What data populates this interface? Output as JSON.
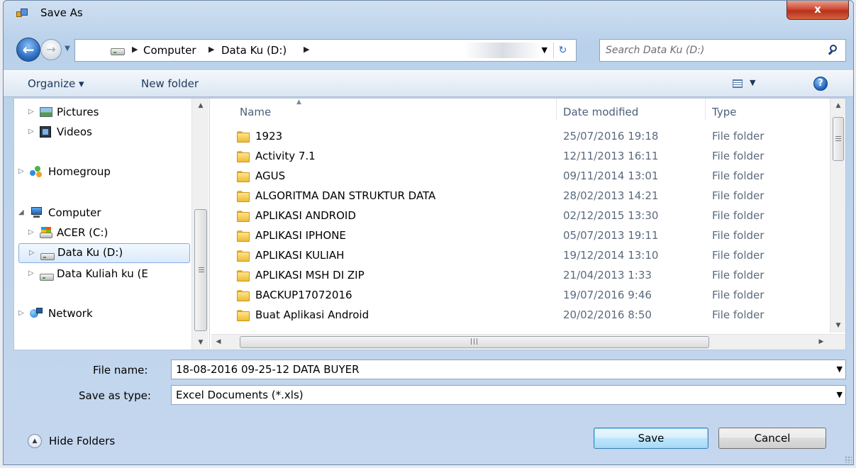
{
  "window": {
    "title": "Save As",
    "close_label": "x"
  },
  "nav": {
    "breadcrumbs": [
      "Computer",
      "Data Ku (D:)"
    ],
    "search_placeholder": "Search Data Ku (D:)"
  },
  "toolbar": {
    "organize": "Organize ▾",
    "new_folder": "New folder"
  },
  "tree": [
    {
      "label": "Pictures",
      "icon": "pictures-icon"
    },
    {
      "label": "Videos",
      "icon": "videos-icon"
    },
    {
      "label": "Homegroup",
      "icon": "homegroup-icon"
    },
    {
      "label": "Computer",
      "icon": "computer-icon"
    },
    {
      "label": "ACER (C:)",
      "icon": "drive-c-icon"
    },
    {
      "label": "Data Ku (D:)",
      "icon": "drive-icon",
      "selected": true
    },
    {
      "label": "Data Kuliah ku (E",
      "icon": "drive-icon"
    },
    {
      "label": "Network",
      "icon": "network-icon"
    }
  ],
  "columns": {
    "name": "Name",
    "date": "Date modified",
    "type": "Type"
  },
  "files": [
    {
      "name": "1923",
      "date": "25/07/2016 19:18",
      "type": "File folder"
    },
    {
      "name": "Activity 7.1",
      "date": "12/11/2013 16:11",
      "type": "File folder"
    },
    {
      "name": "AGUS",
      "date": "09/11/2014 13:01",
      "type": "File folder"
    },
    {
      "name": "ALGORITMA DAN STRUKTUR DATA",
      "date": "28/02/2013 14:21",
      "type": "File folder"
    },
    {
      "name": "APLIKASI ANDROID",
      "date": "02/12/2015 13:30",
      "type": "File folder"
    },
    {
      "name": "APLIKASI IPHONE",
      "date": "05/07/2013 19:11",
      "type": "File folder"
    },
    {
      "name": "APLIKASI KULIAH",
      "date": "19/12/2014 13:10",
      "type": "File folder"
    },
    {
      "name": "APLIKASI MSH DI ZIP",
      "date": "21/04/2013 1:33",
      "type": "File folder"
    },
    {
      "name": "BACKUP17072016",
      "date": "19/07/2016 9:46",
      "type": "File folder"
    },
    {
      "name": "Buat Aplikasi Android",
      "date": "20/02/2016 8:50",
      "type": "File folder"
    }
  ],
  "form": {
    "filename_label": "File name:",
    "filename_value": "18-08-2016 09-25-12 DATA BUYER",
    "savetype_label": "Save as type:",
    "savetype_value": "Excel Documents (*.xls)"
  },
  "footer": {
    "hide_folders": "Hide Folders",
    "save": "Save",
    "cancel": "Cancel"
  }
}
